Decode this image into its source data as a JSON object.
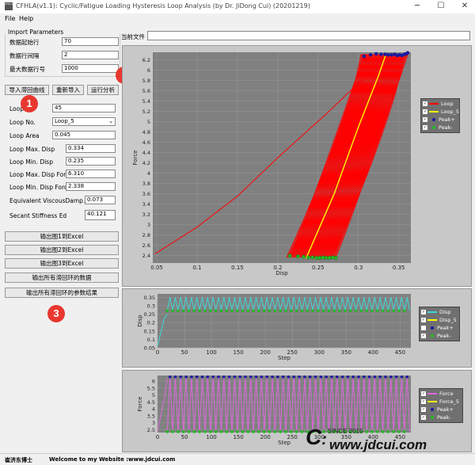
{
  "window": {
    "title": "CFHLA(v1.1): Cyclic/Fatigue Loading Hysteresis Loop Analysis (by Dr. JiDong Cui) (20201219)",
    "app_icon_text": "CFHLA",
    "minimize": "─",
    "maximize": "☐",
    "close": "✕"
  },
  "menu": [
    "File",
    "Help"
  ],
  "current_file_label": "当前文件",
  "current_file_value": "",
  "import": {
    "title": "Import Parameters",
    "start_row_label": "数据起始行",
    "start_row": "70",
    "row_interval_label": "数据行间隔",
    "row_interval": "2",
    "max_row_label": "最大数据行号",
    "max_row": "1000"
  },
  "actions": {
    "import_curve": "导入滞回曲线",
    "reimport": "重新导入",
    "run": "运行分析"
  },
  "params": {
    "loop_count_label": "Loop",
    "loop_count": "45",
    "loop_no_label": "Loop No.",
    "loop_no": "Loop_5",
    "loop_area_label": "Loop Area",
    "loop_area": "0.045",
    "max_disp_label": "Loop Max. Disp",
    "max_disp": "0.334",
    "min_disp_label": "Loop Min. Disp",
    "min_disp": "0.235",
    "max_disp_force_label": "Loop Max. Disp Force",
    "max_disp_force": "6.310",
    "min_disp_force_label": "Loop Min. Disp Force",
    "min_disp_force": "2.338",
    "viscous_label": "Equivalent ViscousDamp. Ratio",
    "viscous": "0.073",
    "secant_label": "Secant Stiffness Ed",
    "secant": "40.121"
  },
  "exports": {
    "fig1": "输出图1到Excel",
    "fig2": "输出图2到Excel",
    "fig3": "输出图3到Excel",
    "all_loops": "输出所有滞回环的数据",
    "all_results": "输出所有滞回环的参数结果"
  },
  "badges": [
    "1",
    "2",
    "3"
  ],
  "status": {
    "author": "崔济东博士",
    "welcome": "Welcome to my Website :",
    "site": "www.jdcui.com"
  },
  "watermark": {
    "since": "SINCE 2015",
    "site": "www.jdcui.com"
  },
  "colors": {
    "chart_bg": "#c8c8c8",
    "plot_bg": "#808080",
    "loop": "#ff0000",
    "highlight": "#ffff00",
    "disp": "#3fd8d8",
    "force": "#dd66dd",
    "peak_plus": "#1a1aa0",
    "peak_minus": "#22bb22",
    "badge": "#e8382f"
  },
  "chart_data": [
    {
      "type": "line",
      "title": "",
      "xlabel": "Disp",
      "ylabel": "Force",
      "xlim": [
        0.045,
        0.365
      ],
      "ylim": [
        2.25,
        6.35
      ],
      "xticks": [
        "0.05",
        "0.1",
        "0.15",
        "0.2",
        "0.25",
        "0.3",
        "0.35"
      ],
      "yticks": [
        "2.4",
        "2.6",
        "2.8",
        "3",
        "3.2",
        "3.4",
        "3.6",
        "3.8",
        "4",
        "4.2",
        "4.4",
        "4.6",
        "4.8",
        "5",
        "5.2",
        "5.4",
        "5.6",
        "5.8",
        "6",
        "6.2"
      ],
      "legend": [
        "Loop",
        "Loop_5",
        "Peak+",
        "Peak-"
      ],
      "legend_checked": [
        true,
        true,
        true,
        true
      ],
      "initial_loading": {
        "x": [
          0.048,
          0.1,
          0.15,
          0.2,
          0.26,
          0.31,
          0.33
        ],
        "y": [
          2.43,
          2.95,
          3.55,
          4.3,
          5.15,
          5.9,
          6.25
        ]
      },
      "peak_plus": {
        "x": [
          0.307,
          0.315,
          0.322,
          0.328,
          0.333,
          0.337,
          0.341,
          0.345,
          0.348,
          0.351,
          0.354,
          0.357,
          0.359,
          0.361
        ],
        "y": [
          6.27,
          6.3,
          6.32,
          6.31,
          6.31,
          6.3,
          6.3,
          6.31,
          6.29,
          6.3,
          6.29,
          6.31,
          6.32,
          6.34
        ]
      },
      "peak_minus": {
        "x": [
          0.215,
          0.225,
          0.232,
          0.238,
          0.243,
          0.248,
          0.252,
          0.256,
          0.26,
          0.264,
          0.268,
          0.272
        ],
        "y": [
          2.39,
          2.38,
          2.37,
          2.36,
          2.36,
          2.35,
          2.35,
          2.36,
          2.35,
          2.35,
          2.36,
          2.35
        ]
      },
      "loop5": {
        "x": [
          0.235,
          0.27,
          0.3,
          0.325,
          0.334
        ],
        "y": [
          2.34,
          3.6,
          4.9,
          5.9,
          6.31
        ]
      }
    },
    {
      "type": "line",
      "title": "",
      "xlabel": "Step",
      "ylabel": "Disp",
      "xlim": [
        0,
        470
      ],
      "ylim": [
        0.05,
        0.37
      ],
      "xticks": [
        "0",
        "50",
        "100",
        "150",
        "200",
        "250",
        "300",
        "350",
        "400",
        "450"
      ],
      "yticks": [
        "0.05",
        "0.1",
        "0.15",
        "0.2",
        "0.25",
        "0.3",
        "0.35"
      ],
      "legend": [
        "Disp",
        "Disp_5",
        "Peak+",
        "Peak-"
      ],
      "legend_checked": [
        true,
        true,
        false,
        true
      ],
      "ramp": {
        "x": [
          0,
          12,
          18
        ],
        "y": [
          0.06,
          0.22,
          0.25
        ]
      },
      "cycle": {
        "start": 18,
        "period": 10,
        "peak": 0.35,
        "trough": 0.27,
        "count": 45
      },
      "highlight_cycle": 5
    },
    {
      "type": "line",
      "title": "",
      "xlabel": "Step",
      "ylabel": "Force",
      "xlim": [
        0,
        470
      ],
      "ylim": [
        2.3,
        6.4
      ],
      "xticks": [
        "0",
        "50",
        "100",
        "150",
        "200",
        "250",
        "300",
        "350",
        "400",
        "450"
      ],
      "yticks": [
        "2.5",
        "3",
        "3.5",
        "4",
        "4.5",
        "5",
        "5.5",
        "6"
      ],
      "legend": [
        "Force",
        "Force_5",
        "Peak+",
        "Peak-"
      ],
      "legend_checked": [
        true,
        true,
        true,
        true
      ],
      "ramp": {
        "x": [
          0,
          12,
          18
        ],
        "y": [
          2.4,
          4.6,
          6.2
        ]
      },
      "cycle": {
        "start": 18,
        "period": 10,
        "peak": 6.3,
        "trough": 2.36,
        "count": 45
      },
      "highlight_cycle": 5
    }
  ]
}
